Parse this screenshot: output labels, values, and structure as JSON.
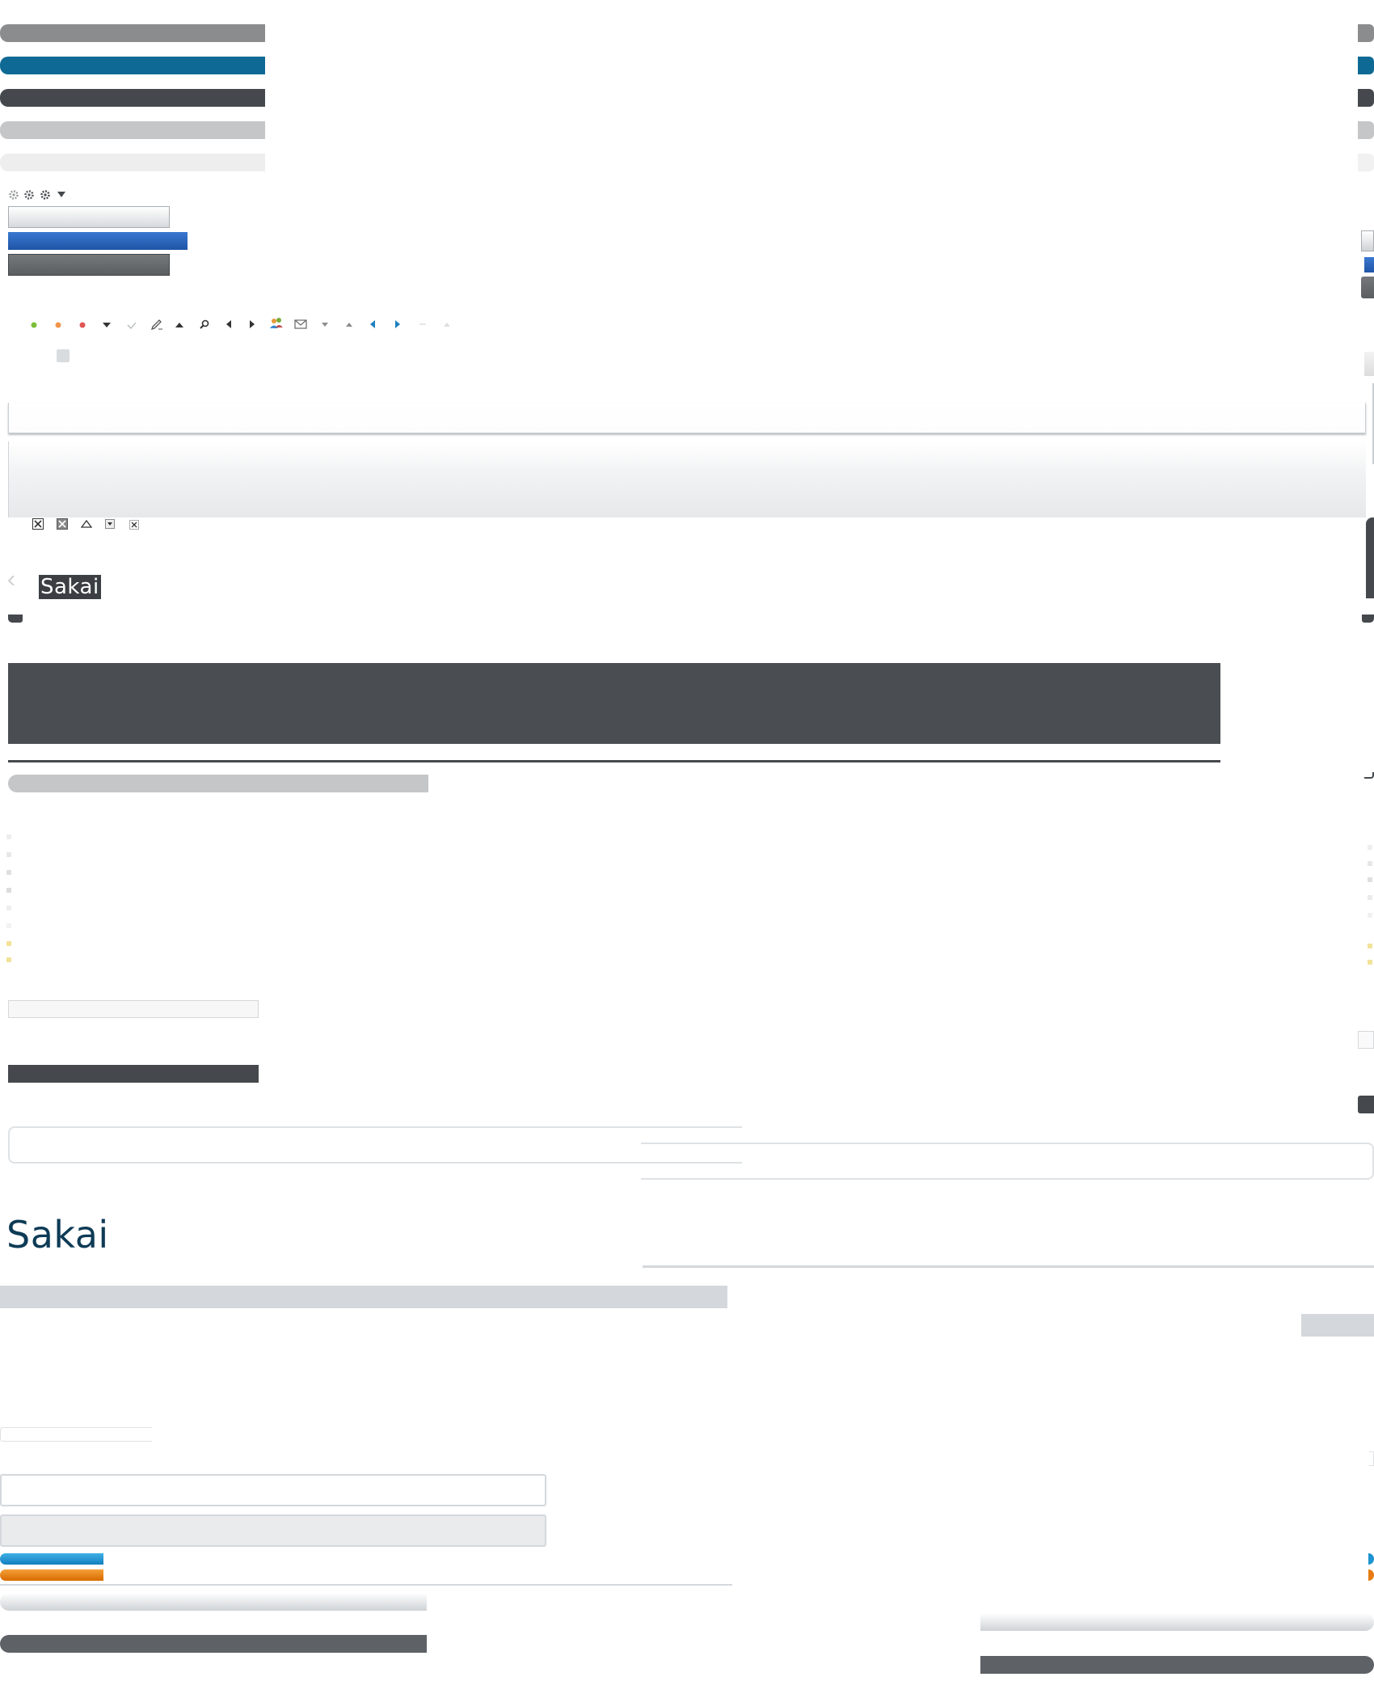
{
  "sprite": {
    "logos": {
      "dark_logo_text": "Sakai",
      "large_logo_text": "Sakai"
    },
    "icons": {
      "gear_row": [
        "gear-icon",
        "gear-icon",
        "gear-icon",
        "caret-down-icon"
      ],
      "toolbar_row": [
        "status-dot-green-icon",
        "status-dot-orange-icon",
        "status-dot-red-icon",
        "caret-down-icon",
        "checkmark-icon",
        "pencil-icon",
        "caret-up-icon",
        "search-icon",
        "arrow-left-icon",
        "arrow-right-icon",
        "users-icon",
        "envelope-icon",
        "caret-down-small-icon",
        "caret-up-small-icon",
        "arrow-left-blue-icon",
        "arrow-right-blue-icon",
        "dash-icon",
        "caret-up-faint-icon"
      ],
      "window_controls": [
        "close-box-icon",
        "close-box-filled-icon",
        "collapse-up-icon",
        "dropdown-box-icon",
        "close-small-icon"
      ],
      "prev_arrow": "chevron-left-icon"
    },
    "colors": {
      "gray": "#8a8c8e",
      "blue": "#0e6a94",
      "dark": "#45494d",
      "light_gray": "#c5c6c7",
      "very_light": "#eeeeee",
      "button_blue": "#2a63b8",
      "charcoal": "#4a4e52",
      "cyan": "#1e94d0",
      "orange": "#e67c12",
      "slate": "#d4d8dc"
    }
  }
}
